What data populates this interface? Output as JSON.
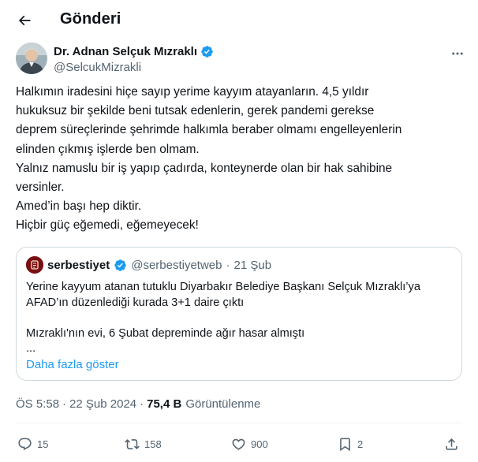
{
  "header": {
    "title": "Gönderi",
    "back_icon": "arrow-left-icon"
  },
  "author": {
    "name": "Dr. Adnan Selçuk Mızraklı",
    "handle": "@SelcukMizrakli",
    "verified_color": "#1d9bf0"
  },
  "tweet": {
    "lines": [
      "Halkımın iradesini hiçe sayıp yerime kayyım atayanların. 4,5 yıldır",
      "hukuksuz bir şekilde beni tutsak edenlerin, gerek pandemi gerekse",
      "deprem süreçlerinde şehrimde halkımla beraber olmamı engelleyenlerin",
      "elinden çıkmış işlerde ben olmam.",
      "Yalnız namuslu bir iş yapıp çadırda, konteynerde olan bir hak sahibine",
      "versinler.",
      "Amed’in başı hep diktir.",
      "Hiçbir güç eğemedi, eğemeyecek!"
    ]
  },
  "quote": {
    "name": "serbestiyet",
    "handle": "@serbestiyetweb",
    "separator": "·",
    "date": "21 Şub",
    "lines": [
      "Yerine kayyum atanan tutuklu Diyarbakır Belediye Başkanı Selçuk Mızraklı’ya",
      "AFAD’ın düzenlediği kurada 3+1 daire çıktı",
      "",
      "Mızraklı'nın evi, 6 Şubat depreminde ağır hasar almıştı",
      "..."
    ],
    "show_more": "Daha fazla göster"
  },
  "meta": {
    "time": "ÖS 5:58",
    "separator": "·",
    "date": "22 Şub 2024",
    "views_count": "75,4 B",
    "views_label": "Görüntülenme"
  },
  "actions": {
    "replies": "15",
    "retweets": "158",
    "likes": "900",
    "bookmarks": "2"
  },
  "colors": {
    "text": "#0f1419",
    "secondary": "#536471",
    "accent": "#1d9bf0",
    "border": "#cfd9de"
  }
}
